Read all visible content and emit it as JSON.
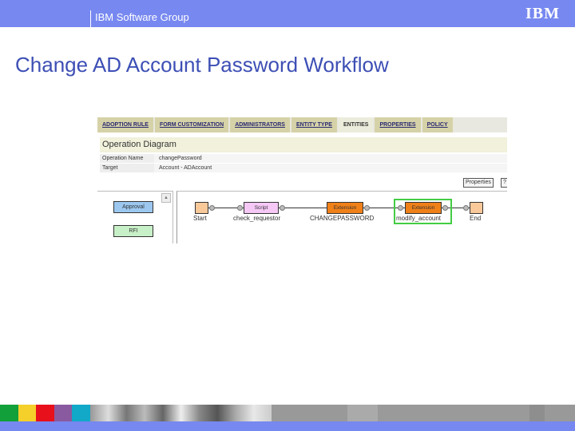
{
  "header": {
    "group": "IBM Software Group",
    "logo": "IBM"
  },
  "slide_title": "Change AD Account Password Workflow",
  "screenshot": {
    "tabs": [
      {
        "label": "ADOPTION RULE"
      },
      {
        "label": "FORM CUSTOMIZATION"
      },
      {
        "label": "ADMINISTRATORS"
      },
      {
        "label": "ENTITY TYPE"
      },
      {
        "label": "ENTITIES",
        "active": true
      },
      {
        "label": "PROPERTIES"
      },
      {
        "label": "POLICY"
      }
    ],
    "section_title": "Operation Diagram",
    "fields": [
      {
        "label": "Operation Name",
        "value": "changePassword"
      },
      {
        "label": "Target",
        "value": "Account - ADAccount"
      }
    ],
    "buttons": {
      "properties": "Properties",
      "other": "?"
    },
    "palette": [
      {
        "label": "Approval",
        "color": "#9cc8f0"
      },
      {
        "label": "RFI",
        "color": "#c8f0c8"
      }
    ],
    "nodes": [
      {
        "type": "",
        "label": "Start",
        "color": "#f9c99a"
      },
      {
        "type": "Script",
        "label": "check_requestor",
        "color": "#f5c8f5"
      },
      {
        "type": "Extension",
        "label": "CHANGEPASSWORD",
        "color": "#f08018"
      },
      {
        "type": "Extension",
        "label": "modify_account",
        "color": "#f08018"
      },
      {
        "type": "",
        "label": "End",
        "color": "#f9c99a"
      }
    ]
  },
  "footer_colors": [
    "#12a03a",
    "#f5cf2a",
    "#e8101a",
    "#8a5aa0",
    "#12a8c8"
  ]
}
